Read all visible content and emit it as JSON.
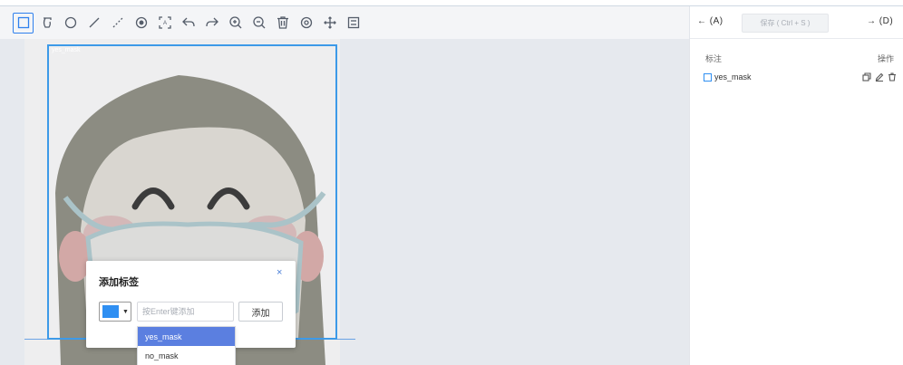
{
  "toolbar": {
    "tools": [
      "rectangle-tool",
      "polygon-tool",
      "circle-tool",
      "line-tool",
      "polyline-tool",
      "point-tool",
      "auto-label-tool",
      "undo",
      "redo",
      "zoom-in",
      "zoom-out",
      "delete",
      "show-hide",
      "move"
    ],
    "active_tool": "rectangle-tool"
  },
  "canvas": {
    "box_label": "yes_mask",
    "box_color": "#3d9ae8"
  },
  "dialog": {
    "title": "添加标签",
    "close_symbol": "×",
    "selected_color": "#2f8ff2",
    "input_placeholder": "按Enter键添加",
    "add_button": "添加",
    "options": [
      "yes_mask",
      "no_mask"
    ],
    "selected_option": "yes_mask"
  },
  "panel": {
    "prev_button": "← (A)",
    "save_button": "保存 ( Ctrl + S )",
    "next_button": "→ (D)",
    "label_header": "标注",
    "ops_header": "操作",
    "annotations": [
      {
        "name": "yes_mask",
        "color": "#2f8ff2"
      }
    ]
  }
}
